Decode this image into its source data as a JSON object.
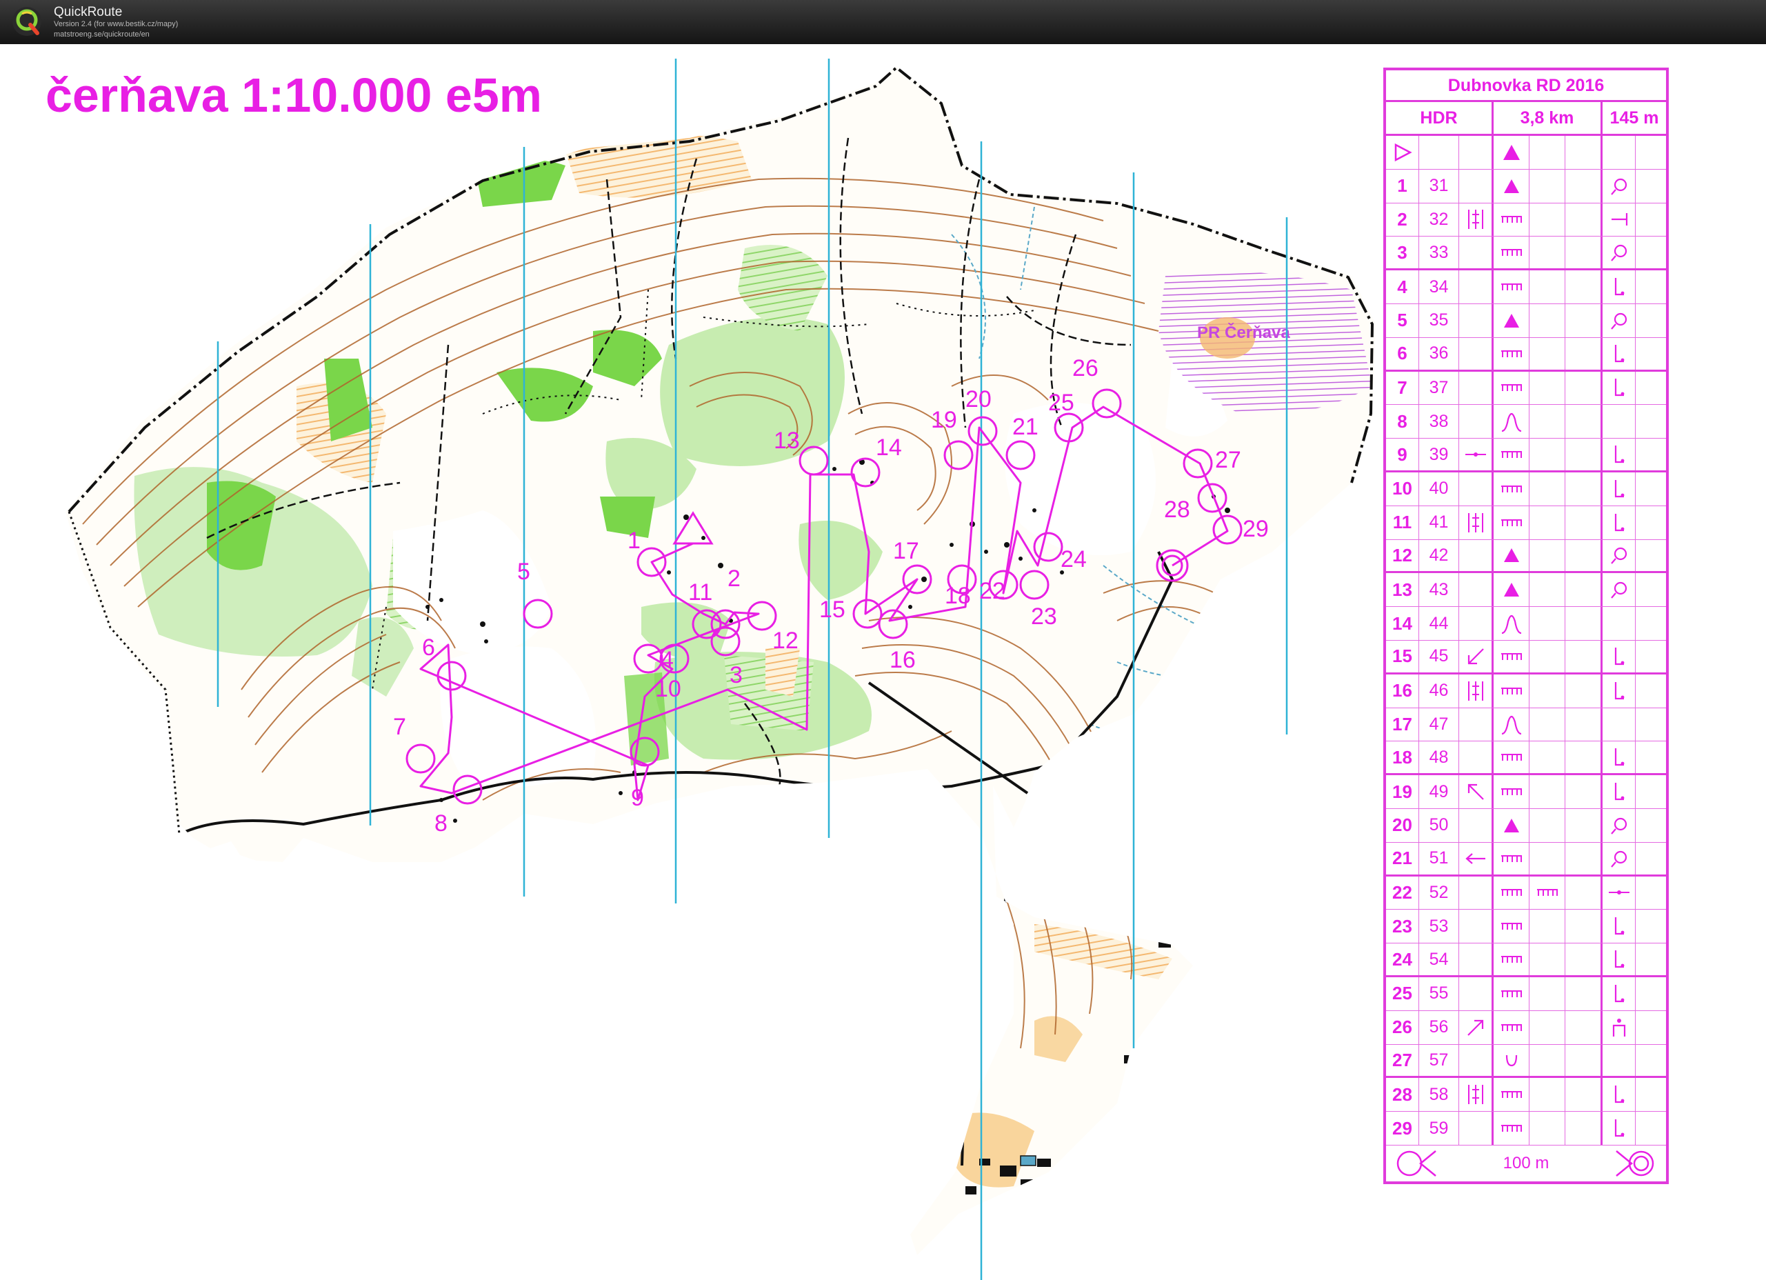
{
  "app": {
    "name": "QuickRoute",
    "version": "Version 2.4  (for www.bestik.cz/mapy)",
    "url": "matstroeng.se/quickroute/en"
  },
  "map": {
    "title": "čerňava 1:10.000 e5m",
    "area_label": "PR Čerňava",
    "colors": {
      "course": "#e81fe4",
      "contour": "#b0652c",
      "forest_green": "#7ad64a",
      "light_green": "#c7ecb0",
      "open_yellow": "#f7c77e",
      "meridian": "#2fb3d6",
      "track": "#111111"
    },
    "controls": [
      {
        "code": "1"
      },
      {
        "code": "2"
      },
      {
        "code": "3"
      },
      {
        "code": "4"
      },
      {
        "code": "5"
      },
      {
        "code": "6"
      },
      {
        "code": "7"
      },
      {
        "code": "8"
      },
      {
        "code": "9"
      },
      {
        "code": "10"
      },
      {
        "code": "11"
      },
      {
        "code": "12"
      },
      {
        "code": "13"
      },
      {
        "code": "14"
      },
      {
        "code": "15"
      },
      {
        "code": "16"
      },
      {
        "code": "17"
      },
      {
        "code": "18"
      },
      {
        "code": "19"
      },
      {
        "code": "20"
      },
      {
        "code": "21"
      },
      {
        "code": "22"
      },
      {
        "code": "23"
      },
      {
        "code": "24"
      },
      {
        "code": "25"
      },
      {
        "code": "26"
      },
      {
        "code": "27"
      },
      {
        "code": "28"
      },
      {
        "code": "29"
      }
    ]
  },
  "description": {
    "event": "Dubnovka RD 2016",
    "category": "HDR",
    "length": "3,8 km",
    "climb": "145 m",
    "finish": "100 m",
    "rows": [
      {
        "num": "1",
        "code": "31",
        "dir": "",
        "feat": "triangle-icon",
        "loc": "knoll-icon"
      },
      {
        "num": "2",
        "code": "32",
        "dir": "wall-icon",
        "feat": "comb-icon",
        "loc": "tee-icon"
      },
      {
        "num": "3",
        "code": "33",
        "dir": "",
        "feat": "comb-icon",
        "loc": "knoll-icon"
      },
      {
        "num": "4",
        "code": "34",
        "dir": "",
        "feat": "comb-icon",
        "loc": "foot-icon"
      },
      {
        "num": "5",
        "code": "35",
        "dir": "",
        "feat": "triangle-icon",
        "loc": "knoll-icon"
      },
      {
        "num": "6",
        "code": "36",
        "dir": "",
        "feat": "comb-icon",
        "loc": "foot-icon"
      },
      {
        "num": "7",
        "code": "37",
        "dir": "",
        "feat": "comb-icon",
        "loc": "foot-icon"
      },
      {
        "num": "8",
        "code": "38",
        "dir": "",
        "feat": "hill-icon",
        "loc": ""
      },
      {
        "num": "9",
        "code": "39",
        "dir": "dash-icon",
        "feat": "comb-icon",
        "loc": "foot-icon"
      },
      {
        "num": "10",
        "code": "40",
        "dir": "",
        "feat": "comb-icon",
        "loc": "foot-icon"
      },
      {
        "num": "11",
        "code": "41",
        "dir": "wall-icon",
        "feat": "comb-icon",
        "loc": "foot-icon"
      },
      {
        "num": "12",
        "code": "42",
        "dir": "",
        "feat": "triangle-icon",
        "loc": "knoll-icon"
      },
      {
        "num": "13",
        "code": "43",
        "dir": "",
        "feat": "triangle-icon",
        "loc": "knoll-icon"
      },
      {
        "num": "14",
        "code": "44",
        "dir": "",
        "feat": "hill-icon",
        "loc": ""
      },
      {
        "num": "15",
        "code": "45",
        "dir": "arrow-sw-icon",
        "feat": "comb-icon",
        "loc": "foot-icon"
      },
      {
        "num": "16",
        "code": "46",
        "dir": "wall-icon",
        "feat": "comb-icon",
        "loc": "foot-icon"
      },
      {
        "num": "17",
        "code": "47",
        "dir": "",
        "feat": "hill-icon",
        "loc": ""
      },
      {
        "num": "18",
        "code": "48",
        "dir": "",
        "feat": "comb-icon",
        "loc": "foot-icon"
      },
      {
        "num": "19",
        "code": "49",
        "dir": "arrow-nw-icon",
        "feat": "comb-icon",
        "loc": "foot-icon"
      },
      {
        "num": "20",
        "code": "50",
        "dir": "",
        "feat": "triangle-icon",
        "loc": "knoll-icon"
      },
      {
        "num": "21",
        "code": "51",
        "dir": "arrow-w-icon",
        "feat": "comb-icon",
        "loc": "knoll-icon"
      },
      {
        "num": "22",
        "code": "52",
        "dir": "",
        "feat": "comb-icon",
        "loc": "dash-icon"
      },
      {
        "num": "23",
        "code": "53",
        "dir": "",
        "feat": "comb-icon",
        "loc": "foot-icon"
      },
      {
        "num": "24",
        "code": "54",
        "dir": "",
        "feat": "comb-icon",
        "loc": "foot-icon"
      },
      {
        "num": "25",
        "code": "55",
        "dir": "",
        "feat": "comb-icon",
        "loc": "foot-icon"
      },
      {
        "num": "26",
        "code": "56",
        "dir": "arrow-ne-icon",
        "feat": "comb-icon",
        "loc": "gate-icon"
      },
      {
        "num": "27",
        "code": "57",
        "dir": "",
        "feat": "cup-icon",
        "loc": ""
      },
      {
        "num": "28",
        "code": "58",
        "dir": "wall-icon",
        "feat": "comb-icon",
        "loc": "foot-icon"
      },
      {
        "num": "29",
        "code": "59",
        "dir": "",
        "feat": "comb-icon",
        "loc": "foot-icon"
      }
    ]
  }
}
